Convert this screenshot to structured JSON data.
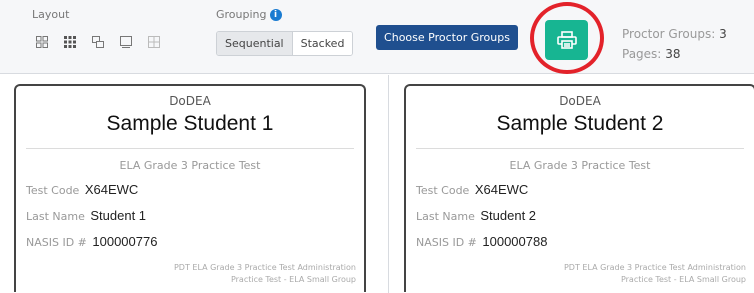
{
  "toolbar": {
    "layout_label": "Layout",
    "grouping_label": "Grouping",
    "grouping_options": [
      "Sequential",
      "Stacked"
    ],
    "choose_proctor_label": "Choose Proctor Groups",
    "proctor_groups_label": "Proctor Groups:",
    "proctor_groups_value": "3",
    "pages_label": "Pages:",
    "pages_value": "38",
    "layout_icons": [
      "grid-small-icon",
      "grid-large-icon",
      "cards-icon",
      "single-page-icon",
      "table-icon"
    ],
    "print_icon": "print-icon",
    "info_icon": "info-icon"
  },
  "cards": [
    {
      "org": "DoDEA",
      "student_name": "Sample Student 1",
      "test_name": "ELA Grade 3 Practice Test",
      "test_code_label": "Test Code",
      "test_code": "X64EWC",
      "last_name_label": "Last Name",
      "last_name": "Student 1",
      "nasis_label": "NASIS ID #",
      "nasis_id": "100000776",
      "footer_line1": "PDT ELA Grade 3 Practice Test Administration",
      "footer_line2": "Practice Test - ELA Small Group"
    },
    {
      "org": "DoDEA",
      "student_name": "Sample Student 2",
      "test_name": "ELA Grade 3 Practice Test",
      "test_code_label": "Test Code",
      "test_code": "X64EWC",
      "last_name_label": "Last Name",
      "last_name": "Student 2",
      "nasis_label": "NASIS ID #",
      "nasis_id": "100000788",
      "footer_line1": "PDT ELA Grade 3 Practice Test Administration",
      "footer_line2": "Practice Test - ELA Small Group"
    }
  ],
  "colors": {
    "primary_button": "#1f4f8f",
    "print_button": "#17b592",
    "highlight": "#e3222a"
  }
}
